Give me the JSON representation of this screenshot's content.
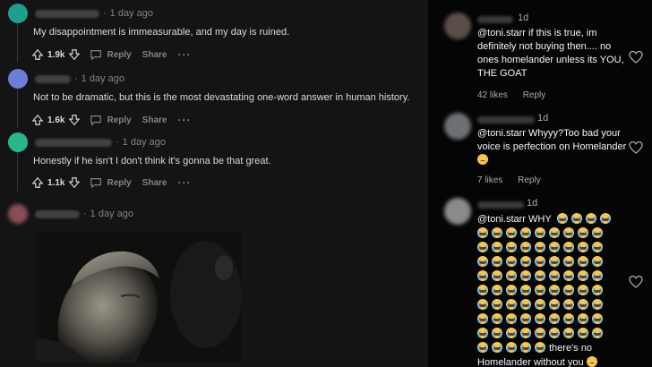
{
  "left_panel": {
    "comments": [
      {
        "time": "1 day ago",
        "body": "My disappointment is immeasurable, and my day is ruined.",
        "score": "1.9k",
        "reply_label": "Reply",
        "share_label": "Share",
        "more_label": "···",
        "avatar_color": "#1e9e8c"
      },
      {
        "time": "1 day ago",
        "body": "Not to be dramatic, but this is the most devastating one-word answer in human history.",
        "score": "1.6k",
        "reply_label": "Reply",
        "share_label": "Share",
        "more_label": "···",
        "avatar_color": "#6f7dd9"
      },
      {
        "time": "1 day ago",
        "body": "Honestly if he isn't I don't think it's gonna be that great.",
        "score": "1.1k",
        "reply_label": "Reply",
        "share_label": "Share",
        "more_label": "···",
        "avatar_color": "#2bb58e"
      },
      {
        "time": "1 day ago",
        "avatar_color": "#8a4d57"
      }
    ],
    "separator": "·"
  },
  "right_panel": {
    "comments": [
      {
        "time": "1d",
        "text": "@toni.starr if this is true, im definitely not buying then.... no ones homelander unless its YOU, THE GOAT",
        "likes": "42 likes",
        "reply_label": "Reply"
      },
      {
        "time": "1d",
        "text": "@toni.starr Whyyy?Too bad your voice is perfection on Homelander",
        "likes": "7 likes",
        "reply_label": "Reply"
      },
      {
        "time": "1d",
        "text_start": "@toni.starr WHY",
        "text_end_a": "there's no",
        "text_end_b": "Homelander without you"
      }
    ]
  },
  "icons": [
    "upvote-icon",
    "downvote-icon",
    "comment-icon",
    "more-icon",
    "heart-icon",
    "loudly-crying-face-emoji",
    "sad-face-emoji"
  ],
  "colors": {
    "left_bg": "#141414",
    "right_bg": "#050505",
    "text": "#d7dadc",
    "muted": "#818384",
    "emoji": "#f5c84c"
  }
}
